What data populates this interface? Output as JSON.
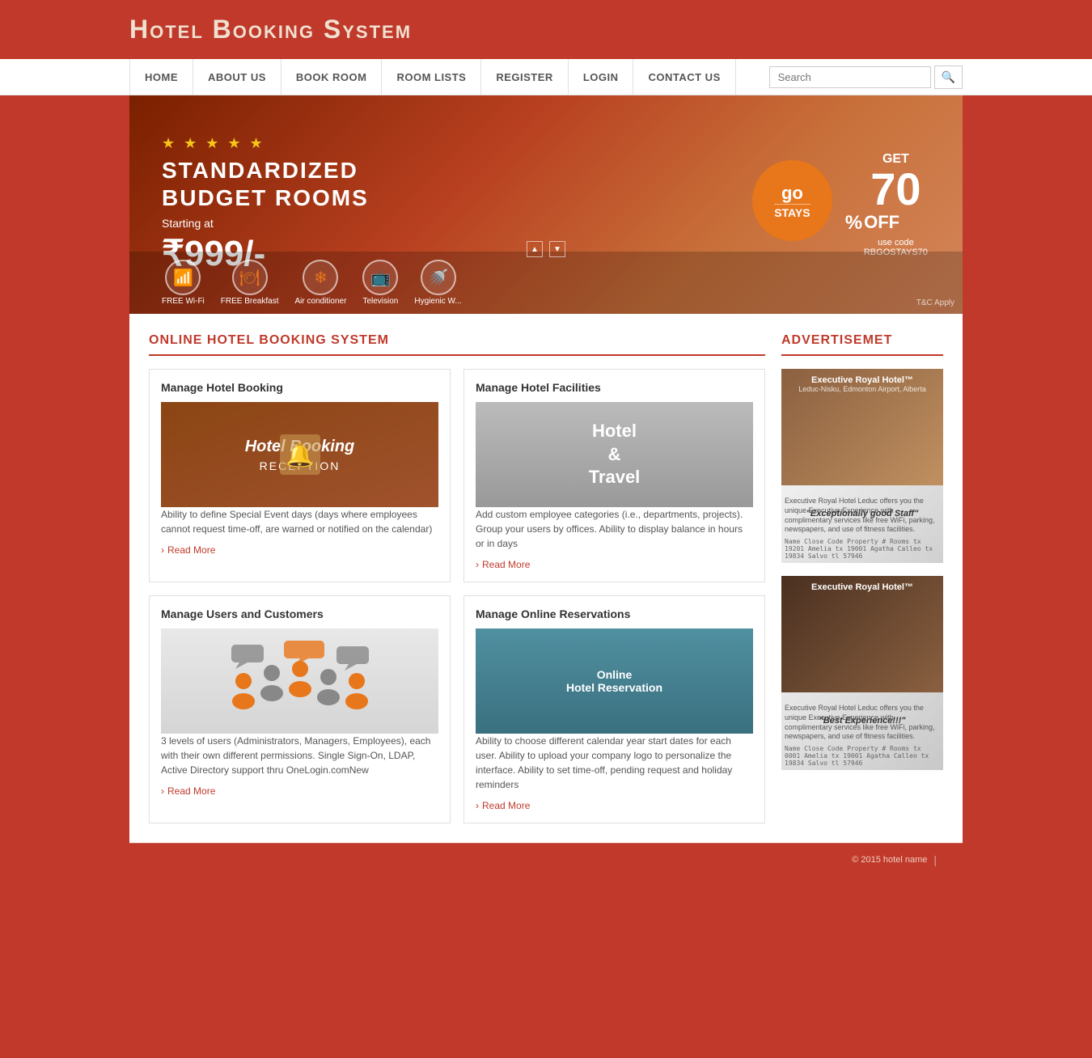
{
  "site": {
    "title": "Hotel Booking System"
  },
  "nav": {
    "items": [
      {
        "label": "HOME",
        "id": "home"
      },
      {
        "label": "ABOUT US",
        "id": "about"
      },
      {
        "label": "BOOK ROOM",
        "id": "book"
      },
      {
        "label": "ROOM LISTS",
        "id": "rooms"
      },
      {
        "label": "REGISTER",
        "id": "register"
      },
      {
        "label": "LOGIN",
        "id": "login"
      },
      {
        "label": "CONTACT US",
        "id": "contact"
      }
    ],
    "search_placeholder": "Search"
  },
  "hero": {
    "stars": "★ ★ ★ ★ ★",
    "title": "STANDARDIZED\nBUDGET ROOMS",
    "starting_label": "Starting at",
    "price": "₹999/-",
    "badge_go": "go",
    "badge_stays": "STAYS",
    "get_label": "GET",
    "discount": "70",
    "percent": "%",
    "off_label": "OFF",
    "code_label": "use code RBGOSTAYS70",
    "tac_label": "T&C Apply",
    "icons": [
      {
        "label": "FREE Wi-Fi",
        "icon": "📶"
      },
      {
        "label": "FREE Breakfast",
        "icon": "🍽"
      },
      {
        "label": "Air conditioner",
        "icon": "❄"
      },
      {
        "label": "Television",
        "icon": "📺"
      },
      {
        "label": "Hygienic W...",
        "icon": "🚿"
      }
    ]
  },
  "main": {
    "left_section_title": "ONLINE HOTEL BOOKING SYSTEM",
    "cards": [
      {
        "title": "Manage Hotel Booking",
        "img_label": "Hotel Booking\nRECEPTION",
        "desc": "Ability to define Special Event days (days where employees cannot request time-off, are warned or notified on the calendar)",
        "read_more": "Read More",
        "type": "hotel"
      },
      {
        "title": "Manage Hotel Facilities",
        "img_label": "Hotel\n&\nTravel",
        "desc": "Add custom employee categories (i.e., departments, projects). Group your users by offices. Ability to display balance in hours or in days",
        "read_more": "Read More",
        "type": "travel"
      },
      {
        "title": "Manage Users and Customers",
        "img_label": "users",
        "desc": "3 levels of users (Administrators, Managers, Employees), each with their own different permissions. Single Sign-On, LDAP, Active Directory support thru OneLogin.comNew",
        "read_more": "Read More",
        "type": "users"
      },
      {
        "title": "Manage Online Reservations",
        "img_label": "Online\nHotel Reservation",
        "desc": "Ability to choose different calendar year start dates for each user. Ability to upload your company logo to personalize the interface. Ability to set time-off, pending request and holiday reminders",
        "read_more": "Read More",
        "type": "reservation"
      }
    ],
    "right_section_title": "ADVERTISEMET",
    "ads": [
      {
        "hotel_name": "Executive Royal Hotel™",
        "location": "Leduc-Nisku, Edmonton Airport, Alberta",
        "tagline": "\"Exceptionally good Staff\"",
        "details": "Executive Royal Hotel\nLeduc offers you the unique Executive Experience with complimentary services like free WiFi, parking, newspapers, and use of fitness facilities.",
        "details2": "Name  Close Code  Property #\nRooms  tx  19201\nAmelia  tx  19001\nAgatha Calleo  tx  19834\nSalvo  tl  57946"
      },
      {
        "hotel_name": "Executive Royal Hotel™",
        "tagline": "\"Best Experience!!!\"",
        "details": "Executive Royal Hotel\nLeduc offers you the unique Executive Experience with complimentary services like free WiFi, parking, newspapers, and use of fitness facilities.",
        "details2": "Name  Close Code  Property #\nRooms  tx  0001\nAmelia  tx  19001\nAgatha Calleo  tx  19834\nSalvo  tl  57946"
      }
    ]
  },
  "footer": {
    "copyright": "© 2015 hotel name",
    "separator": "|"
  }
}
